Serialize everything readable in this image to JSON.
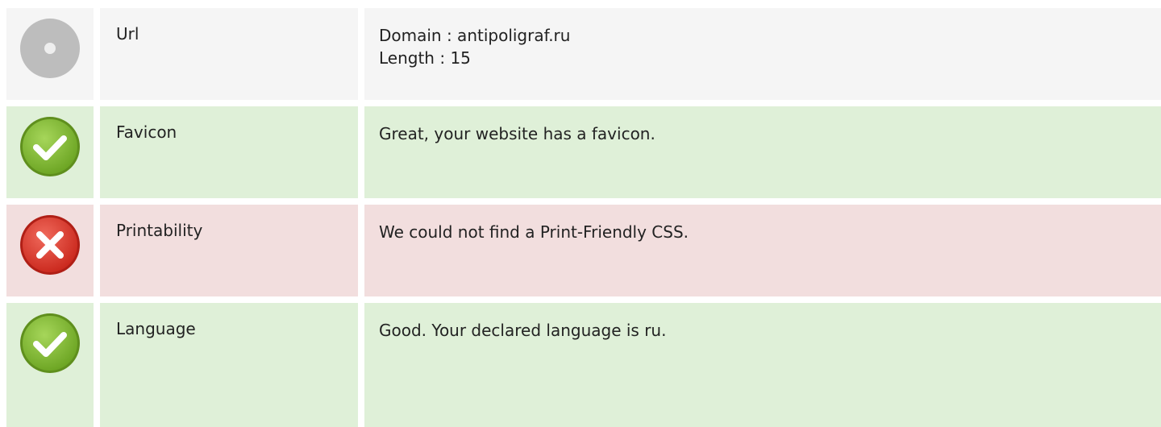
{
  "rows": [
    {
      "status": "neutral",
      "icon": "neutral-dot-icon",
      "label": "Url",
      "values": [
        "Domain : antipoligraf.ru",
        "Length : 15"
      ]
    },
    {
      "status": "pass",
      "icon": "check-circle-icon",
      "label": "Favicon",
      "values": [
        "Great, your website has a favicon."
      ]
    },
    {
      "status": "fail",
      "icon": "x-circle-icon",
      "label": "Printability",
      "values": [
        "We could not find a Print-Friendly CSS."
      ]
    },
    {
      "status": "pass",
      "icon": "check-circle-icon",
      "label": "Language",
      "values": [
        "Good. Your declared language is ru."
      ]
    }
  ],
  "colors": {
    "neutral_bg": "#f5f5f5",
    "pass_bg": "#dff0d8",
    "fail_bg": "#f2dede",
    "pass_icon": "#7cb82f",
    "fail_icon": "#d9372b",
    "neutral_icon": "#bdbdbd"
  }
}
